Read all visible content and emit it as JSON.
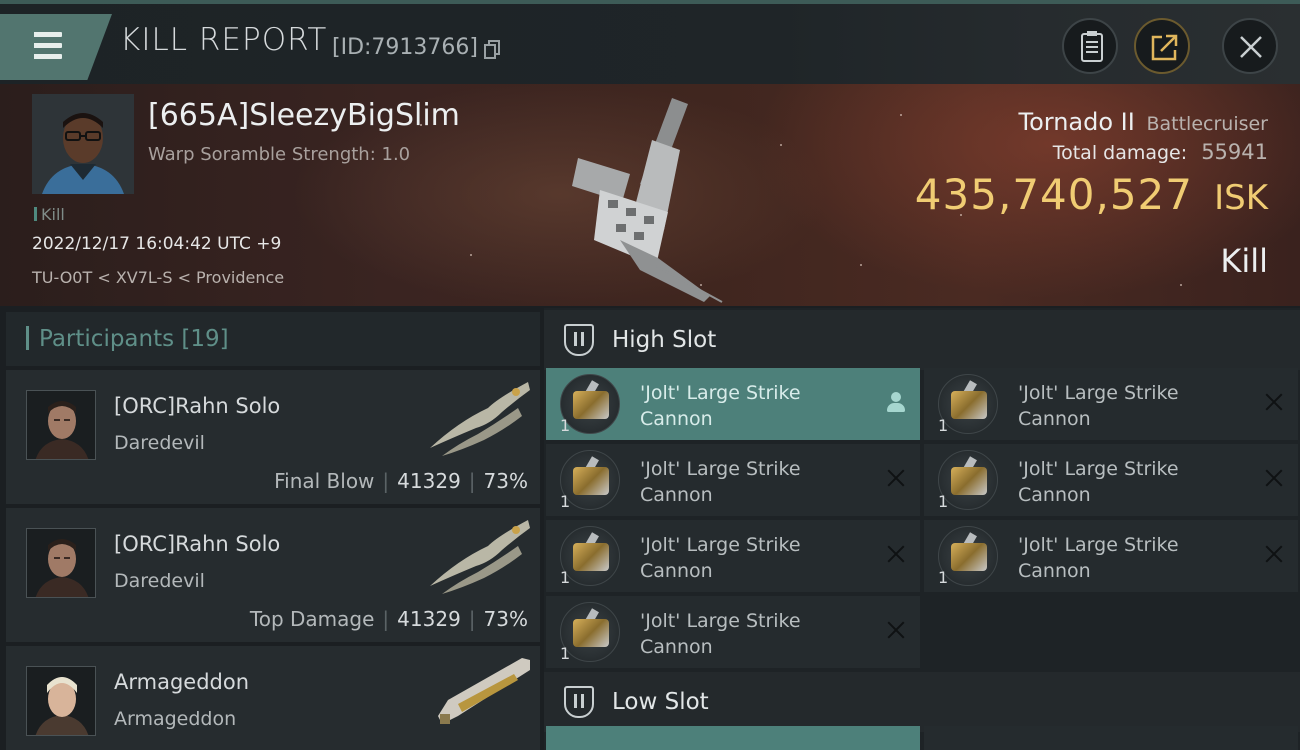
{
  "header": {
    "title": "KILL REPORT",
    "report_id": "[ID:7913766]"
  },
  "victim": {
    "name": "[665A]SleezyBigSlim",
    "warp_scramble": "Warp Soramble Strength: 1.0",
    "tag": "Kill",
    "time": "2022/12/17 16:04:42 UTC +9",
    "location": "TU-O0T < XV7L-S < Providence",
    "ship_name": "Tornado II",
    "ship_class": "Battlecruiser",
    "damage_label": "Total damage:",
    "damage_value": "55941",
    "isk_value": "435,740,527",
    "isk_unit": "ISK",
    "result": "Kill"
  },
  "participants": {
    "header": "Participants [19]",
    "rows": [
      {
        "name": "[ORC]Rahn Solo",
        "ship": "Daredevil",
        "label": "Final Blow",
        "damage": "41329",
        "percent": "73%"
      },
      {
        "name": "[ORC]Rahn Solo",
        "ship": "Daredevil",
        "label": "Top Damage",
        "damage": "41329",
        "percent": "73%"
      },
      {
        "name": "Armageddon",
        "ship": "Armageddon",
        "label": "",
        "damage": "",
        "percent": ""
      }
    ]
  },
  "slots": {
    "high_slot_title": "High Slot",
    "low_slot_title": "Low Slot",
    "high_modules": [
      {
        "name": "'Jolt' Large Strike Cannon",
        "qty": "1",
        "status": "dropped"
      },
      {
        "name": "'Jolt' Large Strike Cannon",
        "qty": "1",
        "status": "destroyed"
      },
      {
        "name": "'Jolt' Large Strike Cannon",
        "qty": "1",
        "status": "destroyed"
      },
      {
        "name": "'Jolt' Large Strike Cannon",
        "qty": "1",
        "status": "destroyed"
      },
      {
        "name": "'Jolt' Large Strike Cannon",
        "qty": "1",
        "status": "destroyed"
      },
      {
        "name": "'Jolt' Large Strike Cannon",
        "qty": "1",
        "status": "destroyed"
      },
      {
        "name": "'Jolt' Large Strike Cannon",
        "qty": "1",
        "status": "destroyed"
      }
    ]
  },
  "colors": {
    "accent": "#52756f",
    "isk_gold": "#f0cc73",
    "selected_module": "#4d807a",
    "banner_red": "#40261f"
  }
}
